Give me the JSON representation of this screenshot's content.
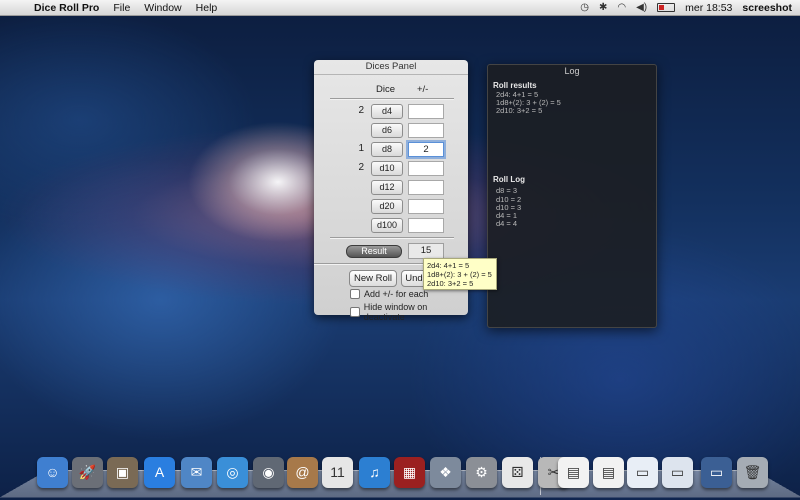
{
  "menubar": {
    "apple": "",
    "app_name": "Dice Roll Pro",
    "items": [
      "File",
      "Window",
      "Help"
    ],
    "clock": "mer 18:53",
    "user": "screeshot"
  },
  "dices_panel": {
    "title": "Dices Panel",
    "col_dice": "Dice",
    "col_mod": "+/-",
    "rows": [
      {
        "count": "2",
        "die": "d4",
        "mod": ""
      },
      {
        "count": "",
        "die": "d6",
        "mod": ""
      },
      {
        "count": "1",
        "die": "d8",
        "mod": "2"
      },
      {
        "count": "2",
        "die": "d10",
        "mod": ""
      },
      {
        "count": "",
        "die": "d12",
        "mod": ""
      },
      {
        "count": "",
        "die": "d20",
        "mod": ""
      },
      {
        "count": "",
        "die": "d100",
        "mod": ""
      }
    ],
    "result_label": "Result",
    "result_value": "15",
    "new_roll": "New Roll",
    "undo": "Und",
    "check_add": "Add +/- for each",
    "check_hide": "Hide window on deactivate"
  },
  "log": {
    "title": "Log",
    "results_heading": "Roll results",
    "results": [
      "2d4: 4+1 = 5",
      "1d8+(2): 3 + (2) = 5",
      "2d10: 3+2 = 5"
    ],
    "roll_log_heading": "Roll Log",
    "roll_log": [
      "d8 = 3",
      "d10 = 2",
      "d10 = 3",
      "d4 = 1",
      "d4 = 4"
    ]
  },
  "tooltip": {
    "lines": [
      "2d4: 4+1 = 5",
      "1d8+(2): 3 + (2) = 5",
      "2d10: 3+2 = 5"
    ]
  },
  "dock": {
    "icons": [
      {
        "name": "finder-icon",
        "glyph": "☺",
        "color": "#3f7fd0"
      },
      {
        "name": "launchpad-icon",
        "glyph": "🚀",
        "color": "#6b6f77"
      },
      {
        "name": "photo-icon",
        "glyph": "▣",
        "color": "#7a6a55"
      },
      {
        "name": "app-store-icon",
        "glyph": "A",
        "color": "#2a7ee0"
      },
      {
        "name": "mail-stamp-icon",
        "glyph": "✉",
        "color": "#4f86c6"
      },
      {
        "name": "safari-icon",
        "glyph": "◎",
        "color": "#3a8fd8"
      },
      {
        "name": "facetime-icon",
        "glyph": "◉",
        "color": "#606874"
      },
      {
        "name": "address-book-icon",
        "glyph": "@",
        "color": "#a7794a"
      },
      {
        "name": "calendar-icon",
        "glyph": "11",
        "color": "#e6e6e6"
      },
      {
        "name": "itunes-icon",
        "glyph": "♫",
        "color": "#2c7fd2"
      },
      {
        "name": "photo-booth-icon",
        "glyph": "▦",
        "color": "#9b2020"
      },
      {
        "name": "preview-icon",
        "glyph": "❖",
        "color": "#7d8a9c"
      },
      {
        "name": "system-preferences-icon",
        "glyph": "⚙",
        "color": "#8b8f96"
      },
      {
        "name": "dice-icon",
        "glyph": "⚄",
        "color": "#e8e8e8"
      },
      {
        "name": "utility-icon",
        "glyph": "✂",
        "color": "#b8b8b8"
      },
      {
        "name": "document-icon",
        "glyph": "▤",
        "color": "#f2f2f2"
      },
      {
        "name": "document-icon-2",
        "glyph": "▤",
        "color": "#f2f2f2"
      },
      {
        "name": "window-icon",
        "glyph": "▭",
        "color": "#e8eef6"
      },
      {
        "name": "window-icon-2",
        "glyph": "▭",
        "color": "#dde4ee"
      },
      {
        "name": "desktop-icon",
        "glyph": "▭",
        "color": "#3b5f94"
      },
      {
        "name": "trash-icon",
        "glyph": "🗑",
        "color": "#a5acb4"
      }
    ]
  }
}
